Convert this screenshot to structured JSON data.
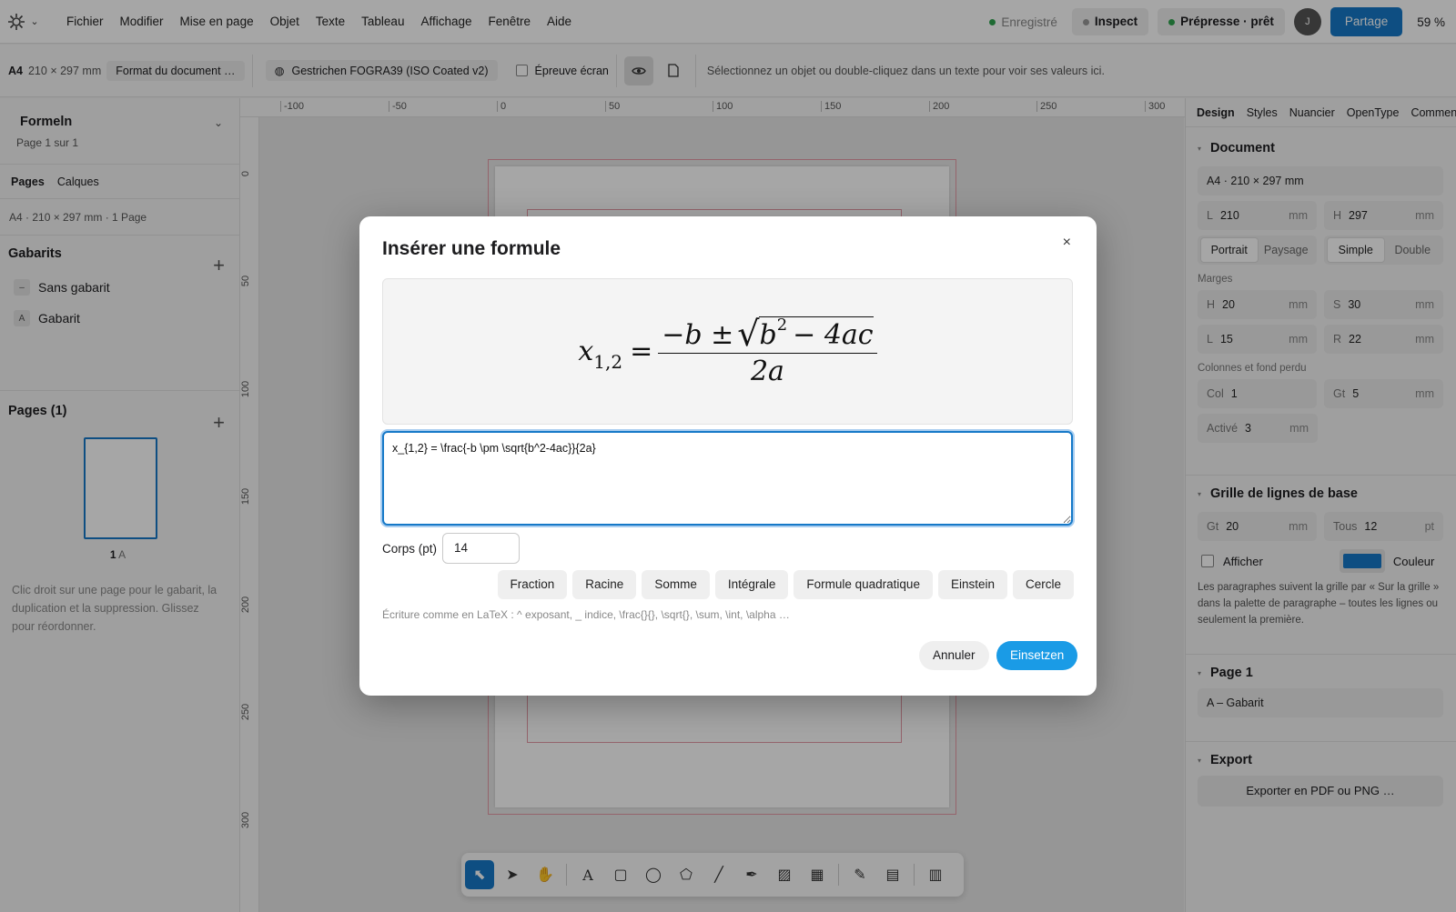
{
  "menubar": {
    "items": [
      "Fichier",
      "Modifier",
      "Mise en page",
      "Objet",
      "Texte",
      "Tableau",
      "Affichage",
      "Fenêtre",
      "Aide"
    ],
    "saved": "Enregistré",
    "inspect": "Inspect",
    "prepress": "Prépresse · prêt",
    "avatar": "J",
    "share": "Partage",
    "zoom": "59 %"
  },
  "toolbar": {
    "size_label": "A4",
    "size_value": "210 × 297 mm",
    "format_btn": "Format du document …",
    "profile": "Gestrichen FOGRA39 (ISO Coated v2)",
    "proof": "Épreuve écran",
    "hint": "Sélectionnez un objet ou double-cliquez dans un texte pour voir ses valeurs ici."
  },
  "left": {
    "doc_title": "Formeln",
    "page_info": "Page 1 sur 1",
    "tabs": [
      "Pages",
      "Calques"
    ],
    "doc_meta": "A4 · 210 × 297 mm · 1 Page",
    "masters_title": "Gabarits",
    "masters": [
      {
        "badge": "–",
        "label": "Sans gabarit"
      },
      {
        "badge": "A",
        "label": "Gabarit"
      }
    ],
    "pages_title": "Pages (1)",
    "thumb_label": "1",
    "thumb_master": "A",
    "help": "Clic droit sur une page pour le gabarit, la duplication et la suppression. Glissez pour réordonner."
  },
  "ruler": {
    "h": [
      "-100",
      "-50",
      "0",
      "50",
      "100",
      "150",
      "200",
      "250",
      "300"
    ],
    "v": [
      "0",
      "50",
      "100",
      "150",
      "200",
      "250",
      "300"
    ]
  },
  "right": {
    "tabs": [
      "Design",
      "Styles",
      "Nuancier",
      "OpenType",
      "Commentai"
    ],
    "document": "Document",
    "format": "A4 · 210 × 297 mm",
    "w_lab": "L",
    "w_val": "210",
    "h_lab": "H",
    "h_val": "297",
    "mm": "mm",
    "pt": "pt",
    "orient": [
      "Portrait",
      "Paysage"
    ],
    "sides": [
      "Simple",
      "Double"
    ],
    "margins": "Marges",
    "m_top_lab": "H",
    "m_top": "20",
    "m_right_lab": "S",
    "m_right": "30",
    "m_left_lab": "L",
    "m_left": "15",
    "m_bottom_lab": "R",
    "m_bottom": "22",
    "cols_title": "Colonnes et fond perdu",
    "col_lab": "Col",
    "col_val": "1",
    "gt_lab": "Gt",
    "gt_val": "5",
    "bleed_lab": "Activé",
    "bleed_val": "3",
    "baseline": "Grille de lignes de base",
    "bgt_lab": "Gt",
    "bgt_val": "20",
    "every_lab": "Tous",
    "every_val": "12",
    "show": "Afficher",
    "color": "Couleur",
    "color_hex": "#1679c8",
    "baseline_note": "Les paragraphes suivent la grille par « Sur la grille » dans la palette de paragraphe – toutes les lignes ou seulement la première.",
    "page1": "Page 1",
    "page_master": "A – Gabarit",
    "export": "Export",
    "export_btn": "Exporter en PDF ou PNG …"
  },
  "dialog": {
    "title": "Insérer une formule",
    "close": "×",
    "latex": "x_{1,2} = \\frac{-b \\pm \\sqrt{b^2-4ac}}{2a}",
    "size_label": "Corps (pt)",
    "size_value": "14",
    "quick": [
      "Fraction",
      "Racine",
      "Somme",
      "Intégrale",
      "Formule quadratique",
      "Einstein",
      "Cercle"
    ],
    "syntax_hint": "Écriture comme en LaTeX : ^ exposant, _ indice, \\frac{}{}, \\sqrt{}, \\sum, \\int, \\alpha …",
    "cancel": "Annuler",
    "insert": "Einsetzen",
    "preview": {
      "x": "x",
      "sub": "1,2",
      "eq": "=",
      "num_a": "−b ±",
      "radicand": "b",
      "sup": "2",
      "rad_rest": "− 4ac",
      "den": "2a"
    }
  }
}
